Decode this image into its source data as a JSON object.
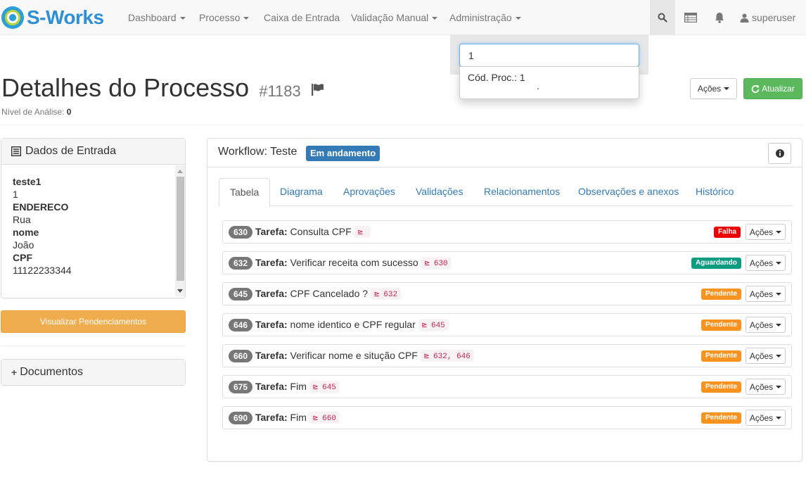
{
  "brand": {
    "name": "S-Works"
  },
  "nav": {
    "items": [
      {
        "label": "Dashboard",
        "dropdown": true
      },
      {
        "label": "Processo",
        "dropdown": true
      },
      {
        "label": "Caixa de Entrada",
        "dropdown": false
      },
      {
        "label": "Validação Manual",
        "dropdown": true
      },
      {
        "label": "Administração",
        "dropdown": true
      }
    ],
    "user": "superuser"
  },
  "search": {
    "value": "1",
    "results": [
      "Cód. Proc.: 1"
    ]
  },
  "page": {
    "title": "Detalhes do Processo",
    "id": "#1183",
    "analysis_label": "Nível de Análise:",
    "analysis_value": "0",
    "actions_label": "Ações",
    "update_label": "Atualizar"
  },
  "input_data": {
    "title": "Dados de Entrada",
    "lines": [
      {
        "text": "teste1",
        "bold": true
      },
      {
        "text": "1",
        "bold": false
      },
      {
        "text": "ENDERECO",
        "bold": true
      },
      {
        "text": "Rua",
        "bold": false
      },
      {
        "text": "nome",
        "bold": true
      },
      {
        "text": "João",
        "bold": false
      },
      {
        "text": "CPF",
        "bold": true
      },
      {
        "text": "11122233344",
        "bold": false
      }
    ]
  },
  "pend_button": "Visualizar Pendenciamentos",
  "documents": {
    "title": "Documentos"
  },
  "workflow": {
    "label": "Workflow:",
    "name": "Teste",
    "status": "Em andamento",
    "tabs": [
      "Tabela",
      "Diagrama",
      "Aprovações",
      "Validações",
      "Relacionamentos",
      "Observações e anexos",
      "Histórico"
    ],
    "active_tab": "Tabela",
    "task_prefix": "Tarefa:",
    "task_actions_label": "Ações",
    "tasks": [
      {
        "id": "630",
        "name": "Consulta CPF",
        "deps": "",
        "status": "Falha",
        "status_type": "falha"
      },
      {
        "id": "632",
        "name": "Verificar receita com sucesso",
        "deps": "630",
        "status": "Aguardando",
        "status_type": "aguard"
      },
      {
        "id": "645",
        "name": "CPF Cancelado ?",
        "deps": "632",
        "status": "Pendente",
        "status_type": "pend"
      },
      {
        "id": "646",
        "name": "nome identico e CPF regular",
        "deps": "645",
        "status": "Pendente",
        "status_type": "pend"
      },
      {
        "id": "660",
        "name": "Verificar nome e situção CPF",
        "deps": "632, 646",
        "status": "Pendente",
        "status_type": "pend"
      },
      {
        "id": "675",
        "name": "Fim",
        "deps": "645",
        "status": "Pendente",
        "status_type": "pend"
      },
      {
        "id": "690",
        "name": "Fim",
        "deps": "660",
        "status": "Pendente",
        "status_type": "pend"
      }
    ]
  },
  "colors": {
    "brand": "#2d8fd5",
    "primary": "#337ab7",
    "success": "#5cb85c",
    "warning": "#f0ad4e",
    "danger": "#ee0000",
    "teal": "#0f9d82",
    "orange": "#f7931e"
  }
}
